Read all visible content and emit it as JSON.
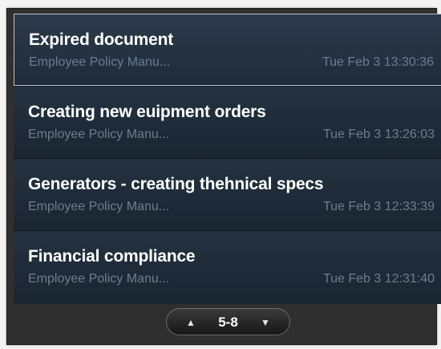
{
  "items": [
    {
      "title": "Expired document",
      "subtitle": "Employee Policy Manu...",
      "date": "Tue Feb 3 13:30:36"
    },
    {
      "title": "Creating new euipment orders",
      "subtitle": "Employee Policy Manu...",
      "date": "Tue Feb 3 13:26:03"
    },
    {
      "title": "Generators - creating thehnical specs",
      "subtitle": "Employee Policy Manu...",
      "date": "Tue Feb 3 12:33:39"
    },
    {
      "title": "Financial compliance",
      "subtitle": "Employee Policy Manu...",
      "date": "Tue Feb 3 12:31:40"
    }
  ],
  "pager": {
    "range": "5-8",
    "up_icon": "up-triangle-icon",
    "down_icon": "down-triangle-icon"
  },
  "colors": {
    "list_background": "#1c2734",
    "title_text": "#ffffff",
    "subtitle_text": "#6c7d8f",
    "selected_border": "#b8c2cf"
  }
}
